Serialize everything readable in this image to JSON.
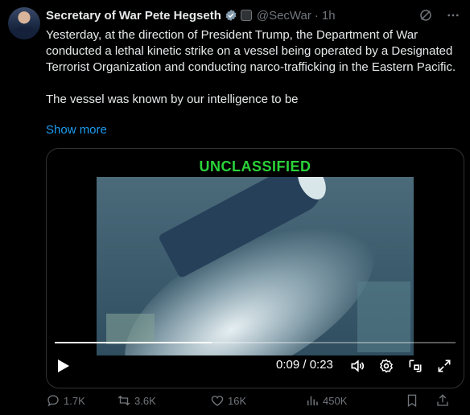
{
  "post": {
    "display_name": "Secretary of War Pete Hegseth",
    "handle": "@SecWar",
    "separator": "·",
    "time": "1h",
    "text_p1": "Yesterday, at the direction of President Trump, the Department of War conducted a lethal kinetic strike on a vessel being operated by a Designated Terrorist Organization and conducting narco-trafficking in the Eastern Pacific.",
    "text_p2": "The vessel was known by our intelligence to be",
    "show_more": "Show more"
  },
  "media": {
    "banner": "UNCLASSIFIED",
    "time_readout": "0:09 / 0:23",
    "progress_fraction": 0.3913
  },
  "actions": {
    "replies": "1.7K",
    "reposts": "3.6K",
    "likes": "16K",
    "views": "450K"
  },
  "icons": {
    "verified": "verified-badge-icon",
    "gov": "government-badge-icon",
    "grok": "grok-icon",
    "more": "more-icon",
    "play": "play-icon",
    "volume": "volume-icon",
    "settings": "settings-icon",
    "pip": "pip-icon",
    "fullscreen": "fullscreen-icon",
    "reply": "reply-icon",
    "repost": "repost-icon",
    "like": "like-icon",
    "views": "views-icon",
    "bookmark": "bookmark-icon",
    "share": "share-icon"
  },
  "colors": {
    "accent": "#1d9bf0",
    "banner": "#2bd33a",
    "muted": "#71767b"
  }
}
